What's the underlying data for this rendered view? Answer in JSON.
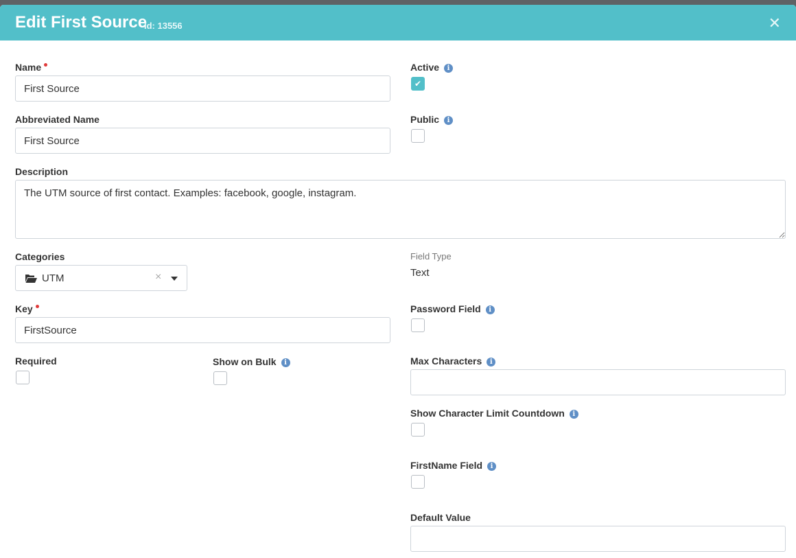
{
  "header": {
    "title": "Edit First Source",
    "id_text": "Id: 13556",
    "close_glyph": "✕"
  },
  "fields": {
    "name": {
      "label": "Name",
      "value": "First Source",
      "required": true
    },
    "abbreviated_name": {
      "label": "Abbreviated Name",
      "value": "First Source"
    },
    "description": {
      "label": "Description",
      "value": "The UTM source of first contact. Examples: facebook, google, instagram."
    },
    "categories": {
      "label": "Categories",
      "value": "UTM",
      "clear_glyph": "×"
    },
    "key": {
      "label": "Key",
      "value": "FirstSource",
      "required": true
    },
    "required": {
      "label": "Required",
      "checked": false
    },
    "show_on_bulk": {
      "label": "Show on Bulk",
      "checked": false
    },
    "active": {
      "label": "Active",
      "checked": true,
      "check_glyph": "✔"
    },
    "public": {
      "label": "Public",
      "checked": false
    },
    "field_type": {
      "label": "Field Type",
      "value": "Text"
    },
    "password_field": {
      "label": "Password Field",
      "checked": false
    },
    "max_characters": {
      "label": "Max Characters",
      "value": ""
    },
    "show_character_limit_countdown": {
      "label": "Show Character Limit Countdown",
      "checked": false
    },
    "firstname_field": {
      "label": "FirstName Field",
      "checked": false
    },
    "default_value": {
      "label": "Default Value",
      "value": ""
    }
  },
  "info_glyph": "i",
  "colors": {
    "accent": "#52bfc9",
    "info": "#5f8fc6",
    "required_dot": "#e03b3b"
  }
}
